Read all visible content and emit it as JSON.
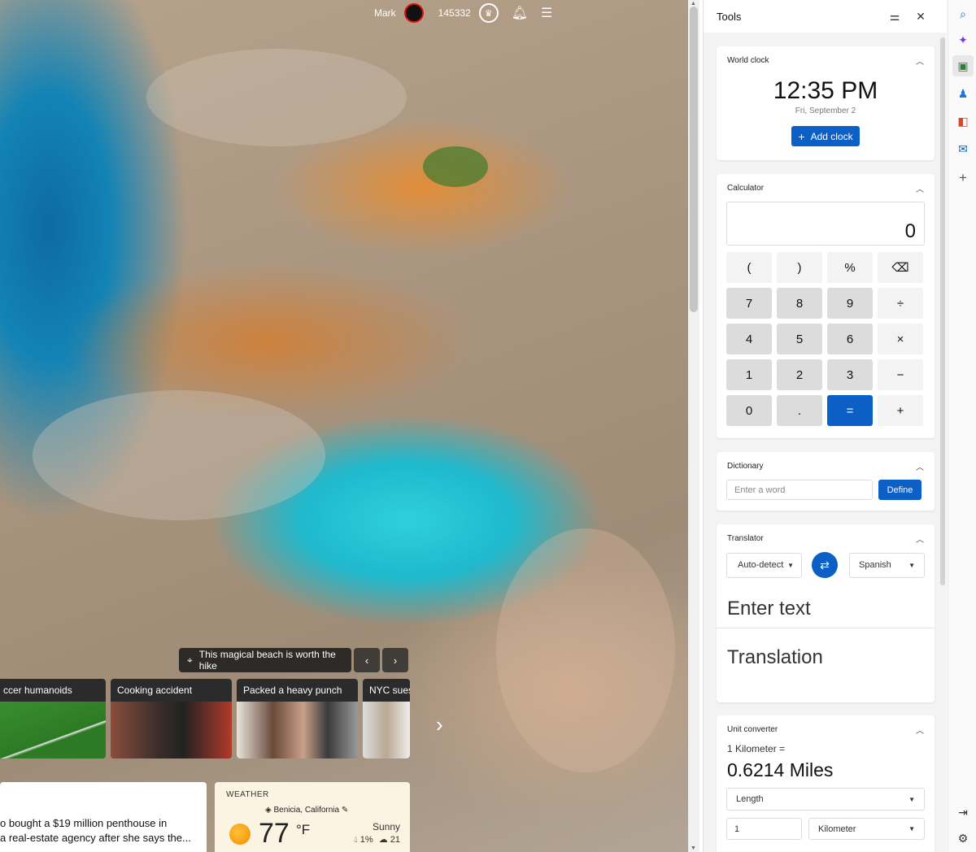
{
  "topbar": {
    "user_name": "Mark",
    "points": "145332"
  },
  "hero": {
    "caption": "This magical beach is worth the hike"
  },
  "news": [
    {
      "label": "ccer humanoids"
    },
    {
      "label": "Cooking accident"
    },
    {
      "label": "Packed a heavy punch"
    },
    {
      "label": "NYC sues c"
    }
  ],
  "story": {
    "text_line1": "o bought a $19 million penthouse in",
    "text_line2": "a real-estate agency after she says the..."
  },
  "weather": {
    "title": "WEATHER",
    "location": "Benicia, California",
    "temp": "77",
    "unit": "°F",
    "condition": "Sunny",
    "precip": "1%",
    "aqi": "21"
  },
  "tools": {
    "title": "Tools",
    "world_clock": {
      "title": "World clock",
      "time": "12:35 PM",
      "date": "Fri, September 2",
      "add_label": "Add clock"
    },
    "calculator": {
      "title": "Calculator",
      "display": "0",
      "keys": [
        "(",
        ")",
        "%",
        "⌫",
        "7",
        "8",
        "9",
        "÷",
        "4",
        "5",
        "6",
        "×",
        "1",
        "2",
        "3",
        "−",
        "0",
        ".",
        "=",
        "+"
      ]
    },
    "dictionary": {
      "title": "Dictionary",
      "placeholder": "Enter a word",
      "button": "Define"
    },
    "translator": {
      "title": "Translator",
      "from": "Auto-detect",
      "to": "Spanish",
      "input_placeholder": "Enter text",
      "output_placeholder": "Translation"
    },
    "unit_converter": {
      "title": "Unit converter",
      "source": "1 Kilometer =",
      "result": "0.6214 Miles",
      "category": "Length",
      "amount": "1",
      "unit": "Kilometer"
    }
  },
  "colors": {
    "accent": "#0c5fc4",
    "card_bg": "#ffffff",
    "pane_bg": "#f3f3f3"
  }
}
